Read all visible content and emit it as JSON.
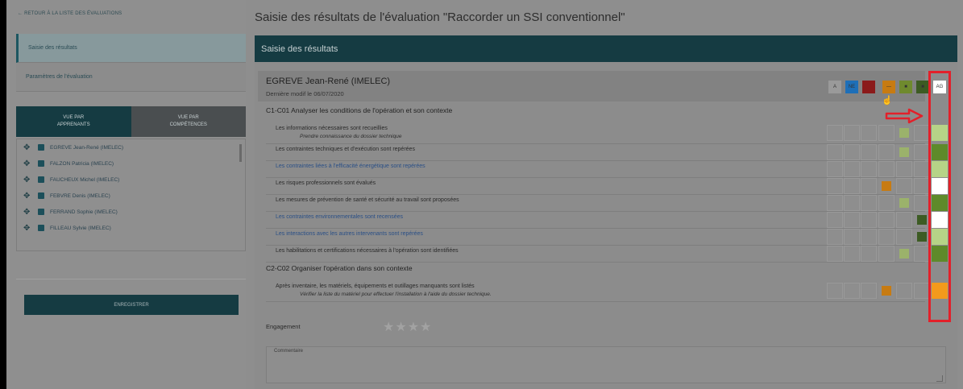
{
  "sidebar": {
    "back_link": "← RETOUR À LA LISTE DES ÉVALUATIONS",
    "menu": [
      {
        "label": "Saisie des résultats",
        "active": true
      },
      {
        "label": "Paramètres de l'évaluation",
        "active": false
      }
    ],
    "tabs": [
      {
        "label": "VUE PAR APPRENANTS",
        "active": true
      },
      {
        "label": "VUE PAR COMPÉTENCES",
        "active": false
      }
    ],
    "learners": [
      "EGREVE Jean-René (IMELEC)",
      "FALZON Patricia (IMELEC)",
      "FAUCHEUX Michel (IMELEC)",
      "FEBVRE Denis (IMELEC)",
      "FERRAND Sophie (IMELEC)",
      "FILLEAU Sylvie (IMELEC)"
    ],
    "save_label": "ENREGISTRER"
  },
  "main": {
    "title": "Saisie des résultats de l'évaluation \"Raccorder un SSI conventionnel\"",
    "section_title": "Saisie des résultats",
    "learner_name": "EGREVE Jean-René (IMELEC)",
    "last_modified": "Dernière modif le 06/07/2020",
    "legend": [
      {
        "label": "A",
        "color": "#9a9a9a"
      },
      {
        "label": "NE",
        "color": "#1e6fb8"
      },
      {
        "label": "",
        "color": "#8b1a1a"
      },
      {
        "label": "—",
        "color": "#c77b12"
      },
      {
        "label": "■",
        "color": "#6f8a2e"
      },
      {
        "label": "■",
        "color": "#3d5b23"
      },
      {
        "label": "AG",
        "color": "#ffffff"
      }
    ],
    "competences": [
      {
        "title": "C1-C01 Analyser les conditions de l'opération et son contexte",
        "criteria": [
          {
            "label": "Les informations nécessaires sont recueillies",
            "note": "Prendre connaissance du dossier technique",
            "link": false,
            "checked": 4,
            "checked_color": "#9bb26b",
            "ag_color": "#b6d387"
          },
          {
            "label": "Les contraintes techniques et d'exécution sont repérées",
            "note": "",
            "link": false,
            "checked": 4,
            "checked_color": "#9bb26b",
            "ag_color": "#5e8a2a"
          },
          {
            "label": "Les contraintes liées à l'efficacité énergétique sont repérées",
            "note": "",
            "link": true,
            "checked": -1,
            "checked_color": "",
            "ag_color": "#b6d387"
          },
          {
            "label": "Les risques professionnels sont évalués",
            "note": "",
            "link": false,
            "checked": 3,
            "checked_color": "#c77b12",
            "ag_color": "#ffffff"
          },
          {
            "label": "Les mesures de prévention de santé et sécurité au travail sont proposées",
            "note": "",
            "link": false,
            "checked": 4,
            "checked_color": "#9bb26b",
            "ag_color": "#5e8a2a"
          },
          {
            "label": "Les contraintes environnementales sont recensées",
            "note": "",
            "link": true,
            "checked": 5,
            "checked_color": "#3d5b23",
            "ag_color": "#ffffff"
          },
          {
            "label": "Les interactions avec les autres intervenants sont repérées",
            "note": "",
            "link": true,
            "checked": 5,
            "checked_color": "#3d5b23",
            "ag_color": "#b6d387"
          },
          {
            "label": "Les habilitations et certifications nécessaires à l'opération sont identifiées",
            "note": "",
            "link": false,
            "checked": 4,
            "checked_color": "#9bb26b",
            "ag_color": "#5e8a2a"
          }
        ]
      },
      {
        "title": "C2-C02 Organiser l'opération dans son contexte",
        "criteria": [
          {
            "label": "Après inventaire, les matériels, équipements et outillages manquants sont listés",
            "note": "Vérifier la liste du matériel pour effectuer l'installation à l'aide du dossier technique.",
            "link": false,
            "checked": 3,
            "checked_color": "#c77b12",
            "ag_color": "#f39a1c"
          }
        ]
      }
    ],
    "engagement_label": "Engagement",
    "stars": "★★★★",
    "comment_label": "Commentaire"
  }
}
